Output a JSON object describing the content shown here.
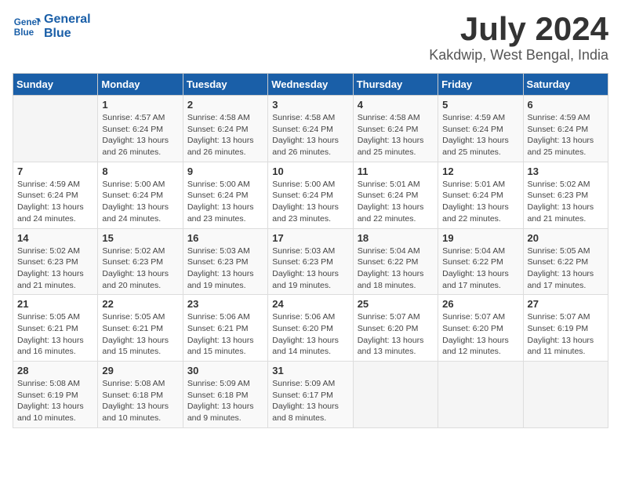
{
  "header": {
    "logo_line1": "General",
    "logo_line2": "Blue",
    "month_year": "July 2024",
    "location": "Kakdwip, West Bengal, India"
  },
  "weekdays": [
    "Sunday",
    "Monday",
    "Tuesday",
    "Wednesday",
    "Thursday",
    "Friday",
    "Saturday"
  ],
  "weeks": [
    [
      {
        "date": "",
        "info": ""
      },
      {
        "date": "1",
        "info": "Sunrise: 4:57 AM\nSunset: 6:24 PM\nDaylight: 13 hours\nand 26 minutes."
      },
      {
        "date": "2",
        "info": "Sunrise: 4:58 AM\nSunset: 6:24 PM\nDaylight: 13 hours\nand 26 minutes."
      },
      {
        "date": "3",
        "info": "Sunrise: 4:58 AM\nSunset: 6:24 PM\nDaylight: 13 hours\nand 26 minutes."
      },
      {
        "date": "4",
        "info": "Sunrise: 4:58 AM\nSunset: 6:24 PM\nDaylight: 13 hours\nand 25 minutes."
      },
      {
        "date": "5",
        "info": "Sunrise: 4:59 AM\nSunset: 6:24 PM\nDaylight: 13 hours\nand 25 minutes."
      },
      {
        "date": "6",
        "info": "Sunrise: 4:59 AM\nSunset: 6:24 PM\nDaylight: 13 hours\nand 25 minutes."
      }
    ],
    [
      {
        "date": "7",
        "info": "Sunrise: 4:59 AM\nSunset: 6:24 PM\nDaylight: 13 hours\nand 24 minutes."
      },
      {
        "date": "8",
        "info": "Sunrise: 5:00 AM\nSunset: 6:24 PM\nDaylight: 13 hours\nand 24 minutes."
      },
      {
        "date": "9",
        "info": "Sunrise: 5:00 AM\nSunset: 6:24 PM\nDaylight: 13 hours\nand 23 minutes."
      },
      {
        "date": "10",
        "info": "Sunrise: 5:00 AM\nSunset: 6:24 PM\nDaylight: 13 hours\nand 23 minutes."
      },
      {
        "date": "11",
        "info": "Sunrise: 5:01 AM\nSunset: 6:24 PM\nDaylight: 13 hours\nand 22 minutes."
      },
      {
        "date": "12",
        "info": "Sunrise: 5:01 AM\nSunset: 6:24 PM\nDaylight: 13 hours\nand 22 minutes."
      },
      {
        "date": "13",
        "info": "Sunrise: 5:02 AM\nSunset: 6:23 PM\nDaylight: 13 hours\nand 21 minutes."
      }
    ],
    [
      {
        "date": "14",
        "info": "Sunrise: 5:02 AM\nSunset: 6:23 PM\nDaylight: 13 hours\nand 21 minutes."
      },
      {
        "date": "15",
        "info": "Sunrise: 5:02 AM\nSunset: 6:23 PM\nDaylight: 13 hours\nand 20 minutes."
      },
      {
        "date": "16",
        "info": "Sunrise: 5:03 AM\nSunset: 6:23 PM\nDaylight: 13 hours\nand 19 minutes."
      },
      {
        "date": "17",
        "info": "Sunrise: 5:03 AM\nSunset: 6:23 PM\nDaylight: 13 hours\nand 19 minutes."
      },
      {
        "date": "18",
        "info": "Sunrise: 5:04 AM\nSunset: 6:22 PM\nDaylight: 13 hours\nand 18 minutes."
      },
      {
        "date": "19",
        "info": "Sunrise: 5:04 AM\nSunset: 6:22 PM\nDaylight: 13 hours\nand 17 minutes."
      },
      {
        "date": "20",
        "info": "Sunrise: 5:05 AM\nSunset: 6:22 PM\nDaylight: 13 hours\nand 17 minutes."
      }
    ],
    [
      {
        "date": "21",
        "info": "Sunrise: 5:05 AM\nSunset: 6:21 PM\nDaylight: 13 hours\nand 16 minutes."
      },
      {
        "date": "22",
        "info": "Sunrise: 5:05 AM\nSunset: 6:21 PM\nDaylight: 13 hours\nand 15 minutes."
      },
      {
        "date": "23",
        "info": "Sunrise: 5:06 AM\nSunset: 6:21 PM\nDaylight: 13 hours\nand 15 minutes."
      },
      {
        "date": "24",
        "info": "Sunrise: 5:06 AM\nSunset: 6:20 PM\nDaylight: 13 hours\nand 14 minutes."
      },
      {
        "date": "25",
        "info": "Sunrise: 5:07 AM\nSunset: 6:20 PM\nDaylight: 13 hours\nand 13 minutes."
      },
      {
        "date": "26",
        "info": "Sunrise: 5:07 AM\nSunset: 6:20 PM\nDaylight: 13 hours\nand 12 minutes."
      },
      {
        "date": "27",
        "info": "Sunrise: 5:07 AM\nSunset: 6:19 PM\nDaylight: 13 hours\nand 11 minutes."
      }
    ],
    [
      {
        "date": "28",
        "info": "Sunrise: 5:08 AM\nSunset: 6:19 PM\nDaylight: 13 hours\nand 10 minutes."
      },
      {
        "date": "29",
        "info": "Sunrise: 5:08 AM\nSunset: 6:18 PM\nDaylight: 13 hours\nand 10 minutes."
      },
      {
        "date": "30",
        "info": "Sunrise: 5:09 AM\nSunset: 6:18 PM\nDaylight: 13 hours\nand 9 minutes."
      },
      {
        "date": "31",
        "info": "Sunrise: 5:09 AM\nSunset: 6:17 PM\nDaylight: 13 hours\nand 8 minutes."
      },
      {
        "date": "",
        "info": ""
      },
      {
        "date": "",
        "info": ""
      },
      {
        "date": "",
        "info": ""
      }
    ]
  ]
}
